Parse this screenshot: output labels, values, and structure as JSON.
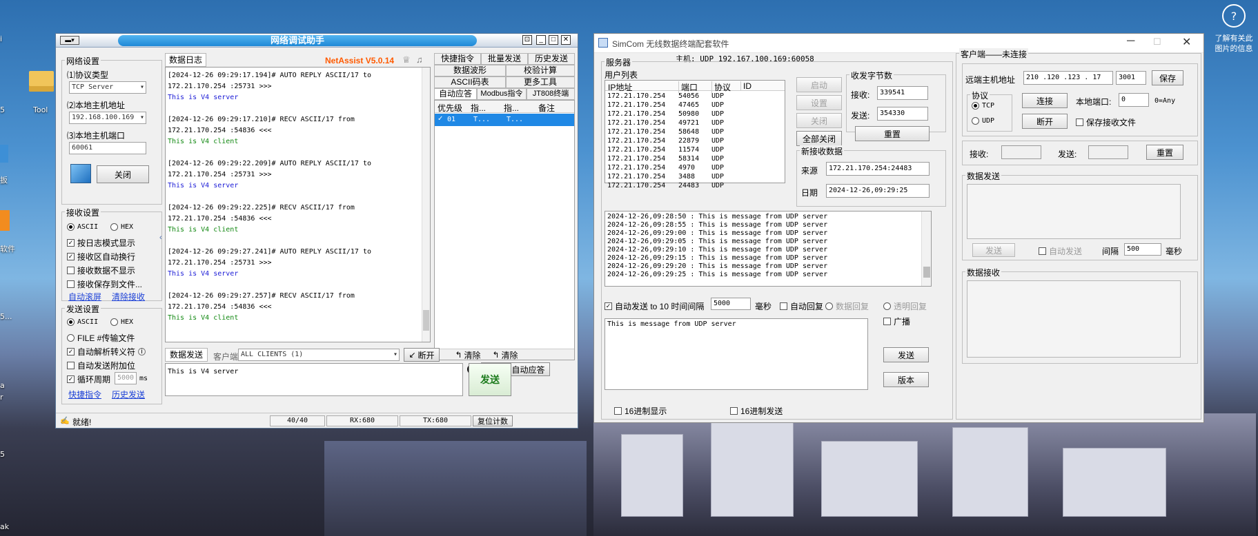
{
  "desktop": {
    "icon_labels": [
      "i",
      "5",
      "Tool",
      "扳",
      "软件",
      "5...",
      "a",
      "r",
      "5",
      "ak"
    ],
    "help_text": "了解有关此图片的信息"
  },
  "netassist": {
    "title": "网络调试助手",
    "brand": "NetAssist V5.0.14",
    "net_settings": {
      "title": "网络设置",
      "protocol_label": "⑴协议类型",
      "protocol_value": "TCP Server",
      "host_label": "⑵本地主机地址",
      "host_value": "192.168.100.169",
      "port_label": "⑶本地主机端口",
      "port_value": "60061",
      "close_button": "关闭"
    },
    "recv_settings": {
      "title": "接收设置",
      "ascii": "ASCII",
      "hex": "HEX",
      "options": [
        {
          "label": "按日志模式显示",
          "checked": true
        },
        {
          "label": "接收区自动换行",
          "checked": true
        },
        {
          "label": "接收数据不显示",
          "checked": false
        },
        {
          "label": "接收保存到文件...",
          "checked": false
        }
      ],
      "link1": "自动滚屏",
      "link2": "清除接收"
    },
    "send_settings": {
      "title": "发送设置",
      "ascii": "ASCII",
      "hex": "HEX",
      "options": [
        {
          "label": "FILE #传输文件",
          "checked": false,
          "radio": true
        },
        {
          "label": "自动解析转义符",
          "checked": true
        },
        {
          "label": "自动发送附加位",
          "checked": false
        },
        {
          "label": "循环周期",
          "checked": true
        }
      ],
      "cycle_value": "5000",
      "cycle_unit": "ms",
      "link1": "快捷指令",
      "link2": "历史发送"
    },
    "log_title": "数据日志",
    "log": [
      {
        "text": "[2024-12-26 09:29:17.194]# AUTO REPLY ASCII/17 to",
        "k": "h"
      },
      {
        "text": "172.21.170.254 :25731 >>>",
        "k": "h"
      },
      {
        "text": "This is V4 server",
        "k": "s"
      },
      {
        "text": "",
        "k": "h"
      },
      {
        "text": "[2024-12-26 09:29:17.210]# RECV ASCII/17 from",
        "k": "h"
      },
      {
        "text": "172.21.170.254 :54836 <<<",
        "k": "h"
      },
      {
        "text": "This is V4 client",
        "k": "c"
      },
      {
        "text": "",
        "k": "h"
      },
      {
        "text": "[2024-12-26 09:29:22.209]# AUTO REPLY ASCII/17 to",
        "k": "h"
      },
      {
        "text": "172.21.170.254 :25731 >>>",
        "k": "h"
      },
      {
        "text": "This is V4 server",
        "k": "s"
      },
      {
        "text": "",
        "k": "h"
      },
      {
        "text": "[2024-12-26 09:29:22.225]# RECV ASCII/17 from",
        "k": "h"
      },
      {
        "text": "172.21.170.254 :54836 <<<",
        "k": "h"
      },
      {
        "text": "This is V4 client",
        "k": "c"
      },
      {
        "text": "",
        "k": "h"
      },
      {
        "text": "[2024-12-26 09:29:27.241]# AUTO REPLY ASCII/17 to",
        "k": "h"
      },
      {
        "text": "172.21.170.254 :25731 >>>",
        "k": "h"
      },
      {
        "text": "This is V4 server",
        "k": "s"
      },
      {
        "text": "",
        "k": "h"
      },
      {
        "text": "[2024-12-26 09:29:27.257]# RECV ASCII/17 from",
        "k": "h"
      },
      {
        "text": "172.21.170.254 :54836 <<<",
        "k": "h"
      },
      {
        "text": "This is V4 client",
        "k": "c"
      }
    ],
    "right_tabs_row1": [
      "快捷指令",
      "批量发送",
      "历史发送"
    ],
    "right_tabs_row2": [
      "数据波形",
      "校验计算"
    ],
    "right_tabs_row3": [
      "ASCII码表",
      "更多工具"
    ],
    "right_tabs_row4": [
      "自动应答",
      "Modbus指令",
      "JT808终端"
    ],
    "reply_columns": [
      "优先级",
      "指...",
      "指...",
      "备注"
    ],
    "reply_row": {
      "priority": "01",
      "c1": "T...",
      "c2": "T..."
    },
    "stop_reply": "停止自动应答",
    "send_bar": {
      "title": "数据发送",
      "client_label": "客户端",
      "client_value": "ALL CLIENTS (1)",
      "disconnect": "断开",
      "clear1": "清除",
      "clear2": "清除"
    },
    "send_text": "This is V4 server",
    "send_button": "发送",
    "status": {
      "ready": "就绪!",
      "count": "40/40",
      "rx": "RX:680",
      "tx": "TX:680",
      "reset": "复位计数"
    }
  },
  "simcom": {
    "title": "SimCom 无线数据终端配套软件",
    "host_line": "主机: UDP 192.167.100.169:60058",
    "server_group": "服务器",
    "user_list": "用户列表",
    "columns": [
      "IP地址",
      "端口",
      "协议",
      "ID"
    ],
    "users": [
      [
        "172.21.170.254",
        "54056",
        "UDP"
      ],
      [
        "172.21.170.254",
        "47465",
        "UDP"
      ],
      [
        "172.21.170.254",
        "50980",
        "UDP"
      ],
      [
        "172.21.170.254",
        "49721",
        "UDP"
      ],
      [
        "172.21.170.254",
        "58648",
        "UDP"
      ],
      [
        "172.21.170.254",
        "22879",
        "UDP"
      ],
      [
        "172.21.170.254",
        "11574",
        "UDP"
      ],
      [
        "172.21.170.254",
        "58314",
        "UDP"
      ],
      [
        "172.21.170.254",
        "4970",
        "UDP"
      ],
      [
        "172.21.170.254",
        "3488",
        "UDP"
      ],
      [
        "172.21.170.254",
        "24483",
        "UDP"
      ]
    ],
    "btn_start": "启动",
    "btn_set": "设置",
    "btn_close": "关闭",
    "btn_close_all": "全部关闭",
    "bytes_group": "收发字节数",
    "recv_label": "接收:",
    "recv_value": "339541",
    "send_label": "发送:",
    "send_value": "354330",
    "reset": "重置",
    "new_data_group": "新接收数据",
    "source_label": "来源",
    "source_value": "172.21.170.254:24483",
    "date_label": "日期",
    "date_value": "2024-12-26,09:29:25",
    "messages": [
      "2024-12-26,09:28:50 : This is message from UDP server",
      "2024-12-26,09:28:55 : This is message from UDP server",
      "2024-12-26,09:29:00 : This is message from UDP server",
      "2024-12-26,09:29:05 : This is message from UDP server",
      "2024-12-26,09:29:10 : This is message from UDP server",
      "2024-12-26,09:29:15 : This is message from UDP server",
      "2024-12-26,09:29:20 : This is message from UDP server",
      "2024-12-26,09:29:25 : This is message from UDP server"
    ],
    "auto_send_label": "自动发送 to 10 时间间隔",
    "auto_send_interval": "5000",
    "ms": "毫秒",
    "auto_reply": "自动回复",
    "data_reply": "数据回复",
    "transparent_reply": "透明回复",
    "broadcast": "广播",
    "send_text": "This is message from UDP server",
    "send_btn": "发送",
    "version_btn": "版本",
    "hex_display": "16进制显示",
    "hex_send": "16进制发送",
    "client": {
      "title": "客户端——未连接",
      "remote_label": "远端主机地址",
      "remote_ip": "210 .120 .123 . 17",
      "remote_port": "3001",
      "save": "保存",
      "protocol": "协议",
      "tcp": "TCP",
      "udp": "UDP",
      "connect": "连接",
      "disconnect": "断开",
      "local_port_label": "本地端口:",
      "local_port": "0",
      "any": "0=Any",
      "save_recv": "保存接收文件",
      "recv_label": "接收:",
      "send_label": "发送:",
      "reset": "重置",
      "send_group": "数据发送",
      "send_btn": "发送",
      "auto_send": "自动发送",
      "interval_label": "间隔",
      "interval": "500",
      "ms": "毫秒",
      "recv_group": "数据接收"
    }
  }
}
